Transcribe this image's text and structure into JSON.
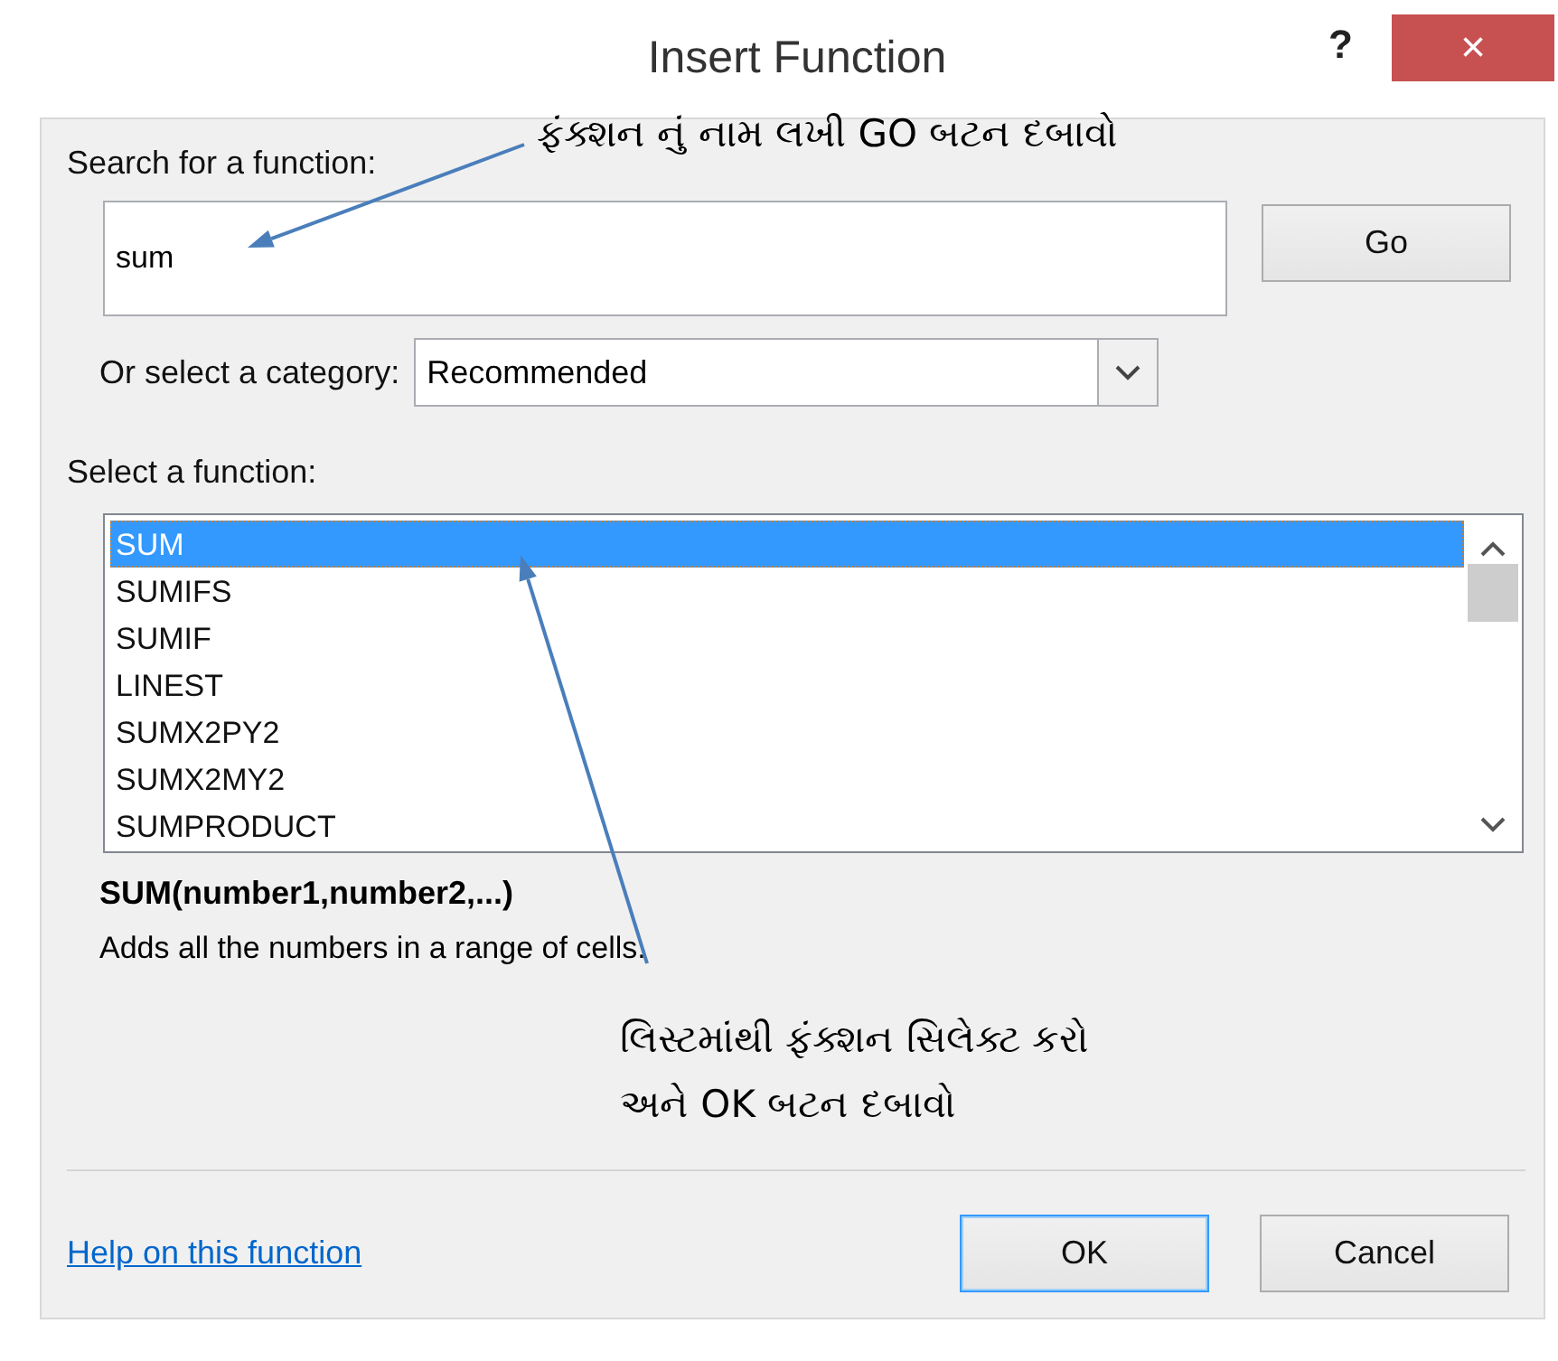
{
  "window": {
    "title": "Insert Function",
    "help": "?",
    "close": "×"
  },
  "search": {
    "label": "Search for a function:",
    "value": "sum",
    "button": "Go"
  },
  "category": {
    "label": "Or select a category:",
    "value": "Recommended"
  },
  "functions": {
    "label": "Select a function:",
    "items": [
      {
        "name": "SUM",
        "selected": true
      },
      {
        "name": "SUMIFS",
        "selected": false
      },
      {
        "name": "SUMIF",
        "selected": false
      },
      {
        "name": "LINEST",
        "selected": false
      },
      {
        "name": "SUMX2PY2",
        "selected": false
      },
      {
        "name": "SUMX2MY2",
        "selected": false
      },
      {
        "name": "SUMPRODUCT",
        "selected": false
      }
    ]
  },
  "signature": "SUM(number1,number2,...)",
  "description": "Adds all the numbers in a range of cells.",
  "annotations": [
    {
      "lines": [
        "ફંક્શન નું નામ લખી  GO બટન દબાવો"
      ]
    },
    {
      "lines": [
        "લિસ્ટમાંથી ફંક્શન સિલેક્ટ કરો",
        "અને OK બટન દબાવો"
      ]
    }
  ],
  "help_link": "Help on this function",
  "buttons": [
    {
      "label": "OK",
      "default": true
    },
    {
      "label": "Cancel",
      "default": false
    }
  ]
}
